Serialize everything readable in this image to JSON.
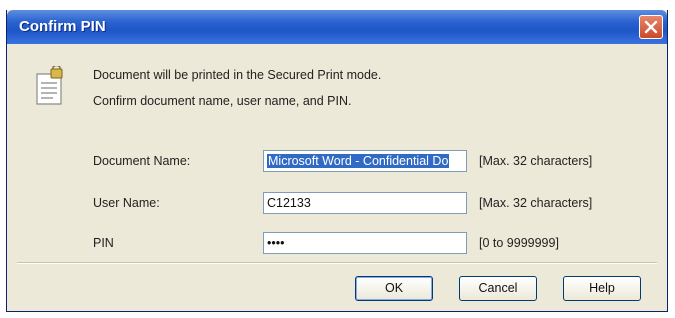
{
  "dialog": {
    "title": "Confirm PIN",
    "message_line1": "Document will be printed in the Secured Print mode.",
    "message_line2": "Confirm document name, user name, and PIN."
  },
  "fields": {
    "document_name": {
      "label": "Document Name:",
      "value": "Microsoft Word - Confidential Do",
      "hint": "[Max. 32 characters]"
    },
    "user_name": {
      "label": "User Name:",
      "value": "C12133",
      "hint": "[Max. 32 characters]"
    },
    "pin": {
      "label": "PIN",
      "value": "••••",
      "hint": "[0 to 9999999]"
    }
  },
  "buttons": {
    "ok": "OK",
    "cancel": "Cancel",
    "help": "Help"
  },
  "icons": {
    "title_close": "close-icon",
    "document_lock": "locked-document-icon"
  }
}
